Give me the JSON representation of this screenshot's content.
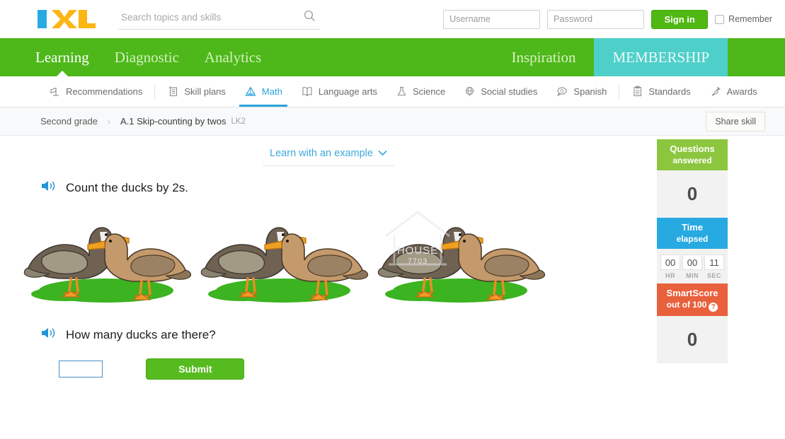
{
  "header": {
    "logo_alt": "IXL",
    "search": {
      "placeholder": "Search topics and skills",
      "value": ""
    },
    "auth": {
      "username_placeholder": "Username",
      "password_placeholder": "Password",
      "signin_label": "Sign in",
      "remember_label": "Remember"
    }
  },
  "main_nav": {
    "items": [
      {
        "label": "Learning",
        "active": true
      },
      {
        "label": "Diagnostic",
        "active": false
      },
      {
        "label": "Analytics",
        "active": false
      }
    ],
    "inspiration_label": "Inspiration",
    "membership_label": "MEMBERSHIP"
  },
  "subject_nav": {
    "items": [
      {
        "label": "Recommendations",
        "icon": "recommendations-icon",
        "active": false
      },
      {
        "label": "Skill plans",
        "icon": "skill-plans-icon",
        "active": false
      },
      {
        "label": "Math",
        "icon": "math-icon",
        "active": true
      },
      {
        "label": "Language arts",
        "icon": "language-arts-icon",
        "active": false
      },
      {
        "label": "Science",
        "icon": "science-icon",
        "active": false
      },
      {
        "label": "Social studies",
        "icon": "social-studies-icon",
        "active": false
      },
      {
        "label": "Spanish",
        "icon": "spanish-icon",
        "active": false
      },
      {
        "label": "Standards",
        "icon": "standards-icon",
        "active": false
      },
      {
        "label": "Awards",
        "icon": "awards-icon",
        "active": false
      }
    ]
  },
  "breadcrumb": {
    "grade": "Second grade",
    "separator": "›",
    "skill": "A.1 Skip-counting by twos",
    "code": "LK2",
    "share_label": "Share skill"
  },
  "exercise": {
    "learn_example_label": "Learn with an example",
    "instruction": "Count the ducks by 2s.",
    "question": "How many ducks are there?",
    "answer_value": "",
    "submit_label": "Submit",
    "duck_groups": 3,
    "ducks_per_group": 2,
    "watermark_text": "HOUSE",
    "watermark_sub": "7703"
  },
  "sidebar": {
    "questions_answered": {
      "title_line1": "Questions",
      "title_line2": "answered",
      "value": "0",
      "color": "#8cc63e"
    },
    "time_elapsed": {
      "title_line1": "Time",
      "title_line2": "elapsed",
      "color": "#27a9e1",
      "hours": "00",
      "minutes": "00",
      "seconds": "11",
      "hr_label": "HR",
      "min_label": "MIN",
      "sec_label": "SEC"
    },
    "smartscore": {
      "title_line1": "SmartScore",
      "title_line2": "out of 100",
      "help": "?",
      "value": "0",
      "color": "#e8613c"
    }
  }
}
